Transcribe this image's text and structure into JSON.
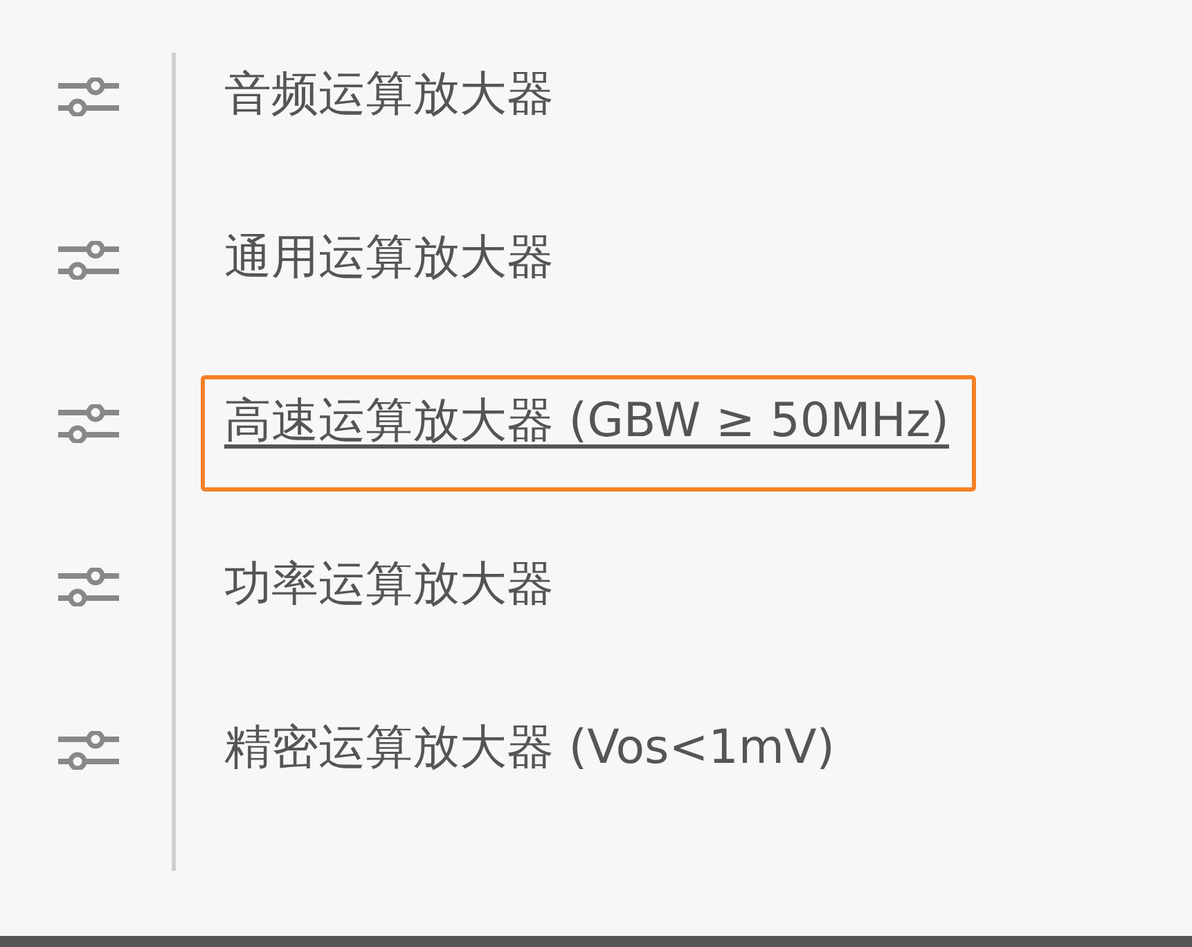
{
  "menu": {
    "items": [
      {
        "label": "音频运算放大器",
        "selected": false
      },
      {
        "label": "通用运算放大器",
        "selected": false
      },
      {
        "label": "高速运算放大器 (GBW ≥ 50MHz)",
        "selected": true
      },
      {
        "label": "功率运算放大器",
        "selected": false
      },
      {
        "label": "精密运算放大器 (Vos<1mV)",
        "selected": false
      }
    ]
  }
}
